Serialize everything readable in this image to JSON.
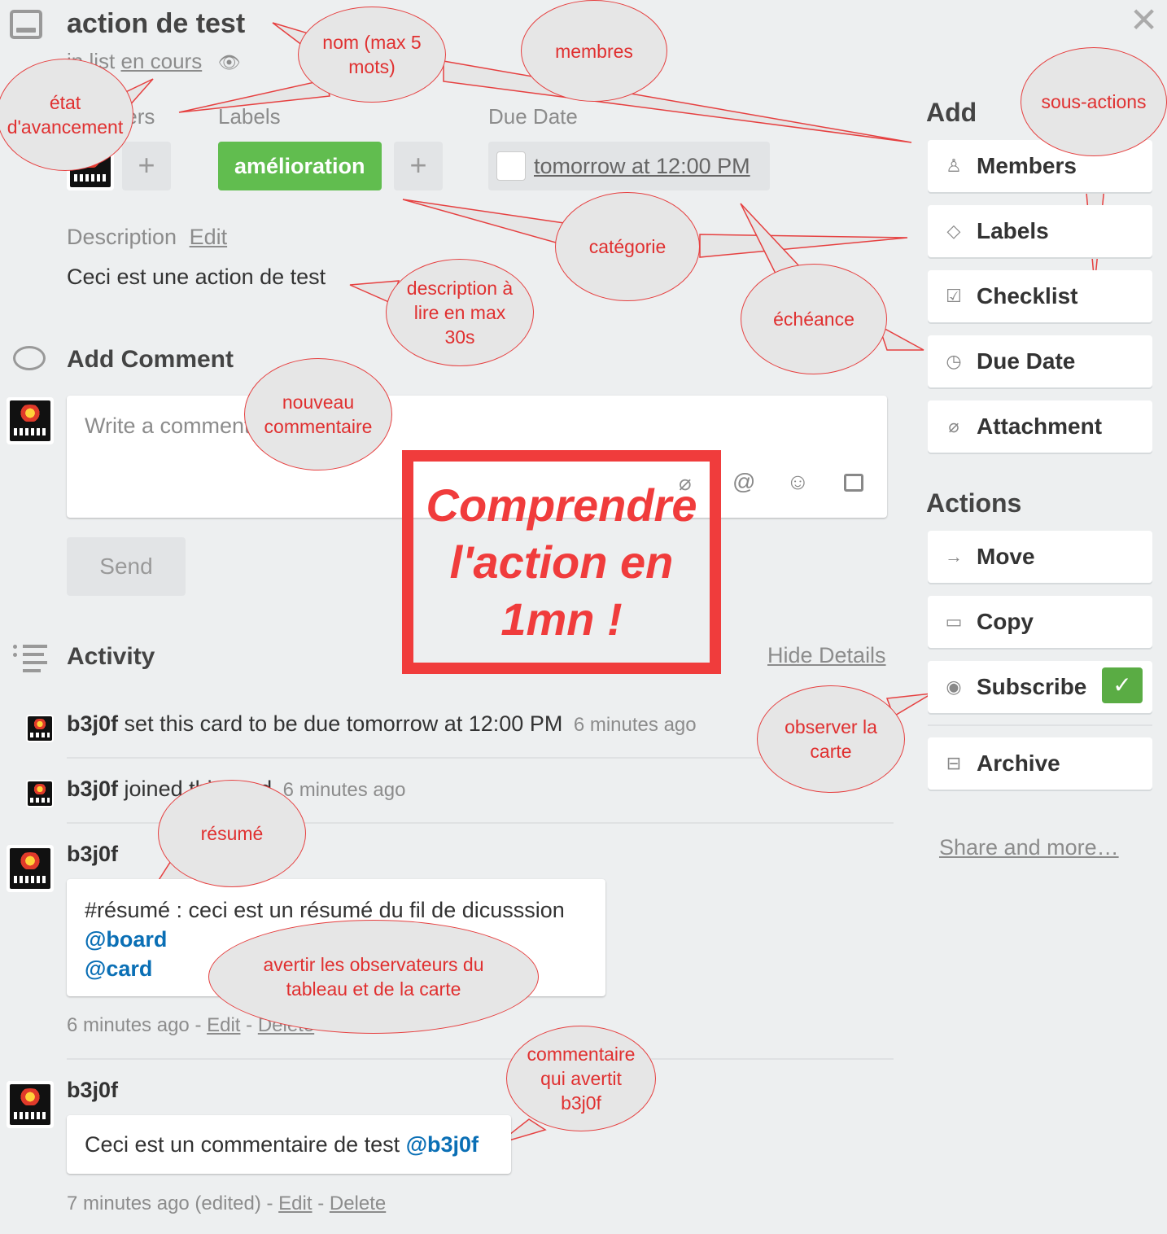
{
  "card": {
    "title": "action de test",
    "list_prefix": "in list",
    "list_name": "en cours"
  },
  "sections": {
    "members_label": "Members",
    "labels_label": "Labels",
    "due_label": "Due Date",
    "label_tag": "amélioration",
    "label_color": "#61bd4f",
    "due_value": "tomorrow at 12:00 PM",
    "description_label": "Description",
    "description_edit": "Edit",
    "description_text": "Ceci est une action de test",
    "add_comment": "Add Comment",
    "comment_placeholder": "Write a comment…",
    "send": "Send",
    "activity": "Activity",
    "hide_details": "Hide Details"
  },
  "activity": [
    {
      "user": "b3j0f",
      "text": "set this card to be due tomorrow at 12:00 PM",
      "time": "6 minutes ago"
    },
    {
      "user": "b3j0f",
      "text": "joined this card",
      "time": "6 minutes ago"
    }
  ],
  "comments": [
    {
      "user": "b3j0f",
      "line1": "#résumé : ceci est un résumé du fil de dicusssion",
      "mention1": "@board",
      "mention2": "@card",
      "time": "6 minutes ago",
      "edit": "Edit",
      "delete": "Delete",
      "sep": "-"
    },
    {
      "user": "b3j0f",
      "text": "Ceci est un commentaire de test ",
      "mention": "@b3j0f",
      "time": "7 minutes ago (edited)",
      "edit": "Edit",
      "delete": "Delete",
      "sep": "-"
    }
  ],
  "sidebar": {
    "add_title": "Add",
    "add_items": [
      "Members",
      "Labels",
      "Checklist",
      "Due Date",
      "Attachment"
    ],
    "actions_title": "Actions",
    "action_items": [
      "Move",
      "Copy",
      "Subscribe",
      "Archive"
    ],
    "share": "Share and more…",
    "subscribe_color": "#5aac44"
  },
  "annotations": {
    "nom": "nom (max 5 mots)",
    "membres": "membres",
    "etat": "état d'avancement",
    "sous_actions": "sous-actions",
    "categorie": "catégorie",
    "description": "description à lire en max 30s",
    "echeance": "échéance",
    "nouveau": "nouveau commentaire",
    "big_box": "Comprendre l'action en 1mn !",
    "observer": "observer la carte",
    "resume": "résumé",
    "avertir": "avertir les observateurs du tableau et de la carte",
    "commentaire": "commentaire qui avertit b3j0f"
  },
  "colors": {
    "annotation": "#e03030",
    "mention": "#0a6fb5"
  }
}
